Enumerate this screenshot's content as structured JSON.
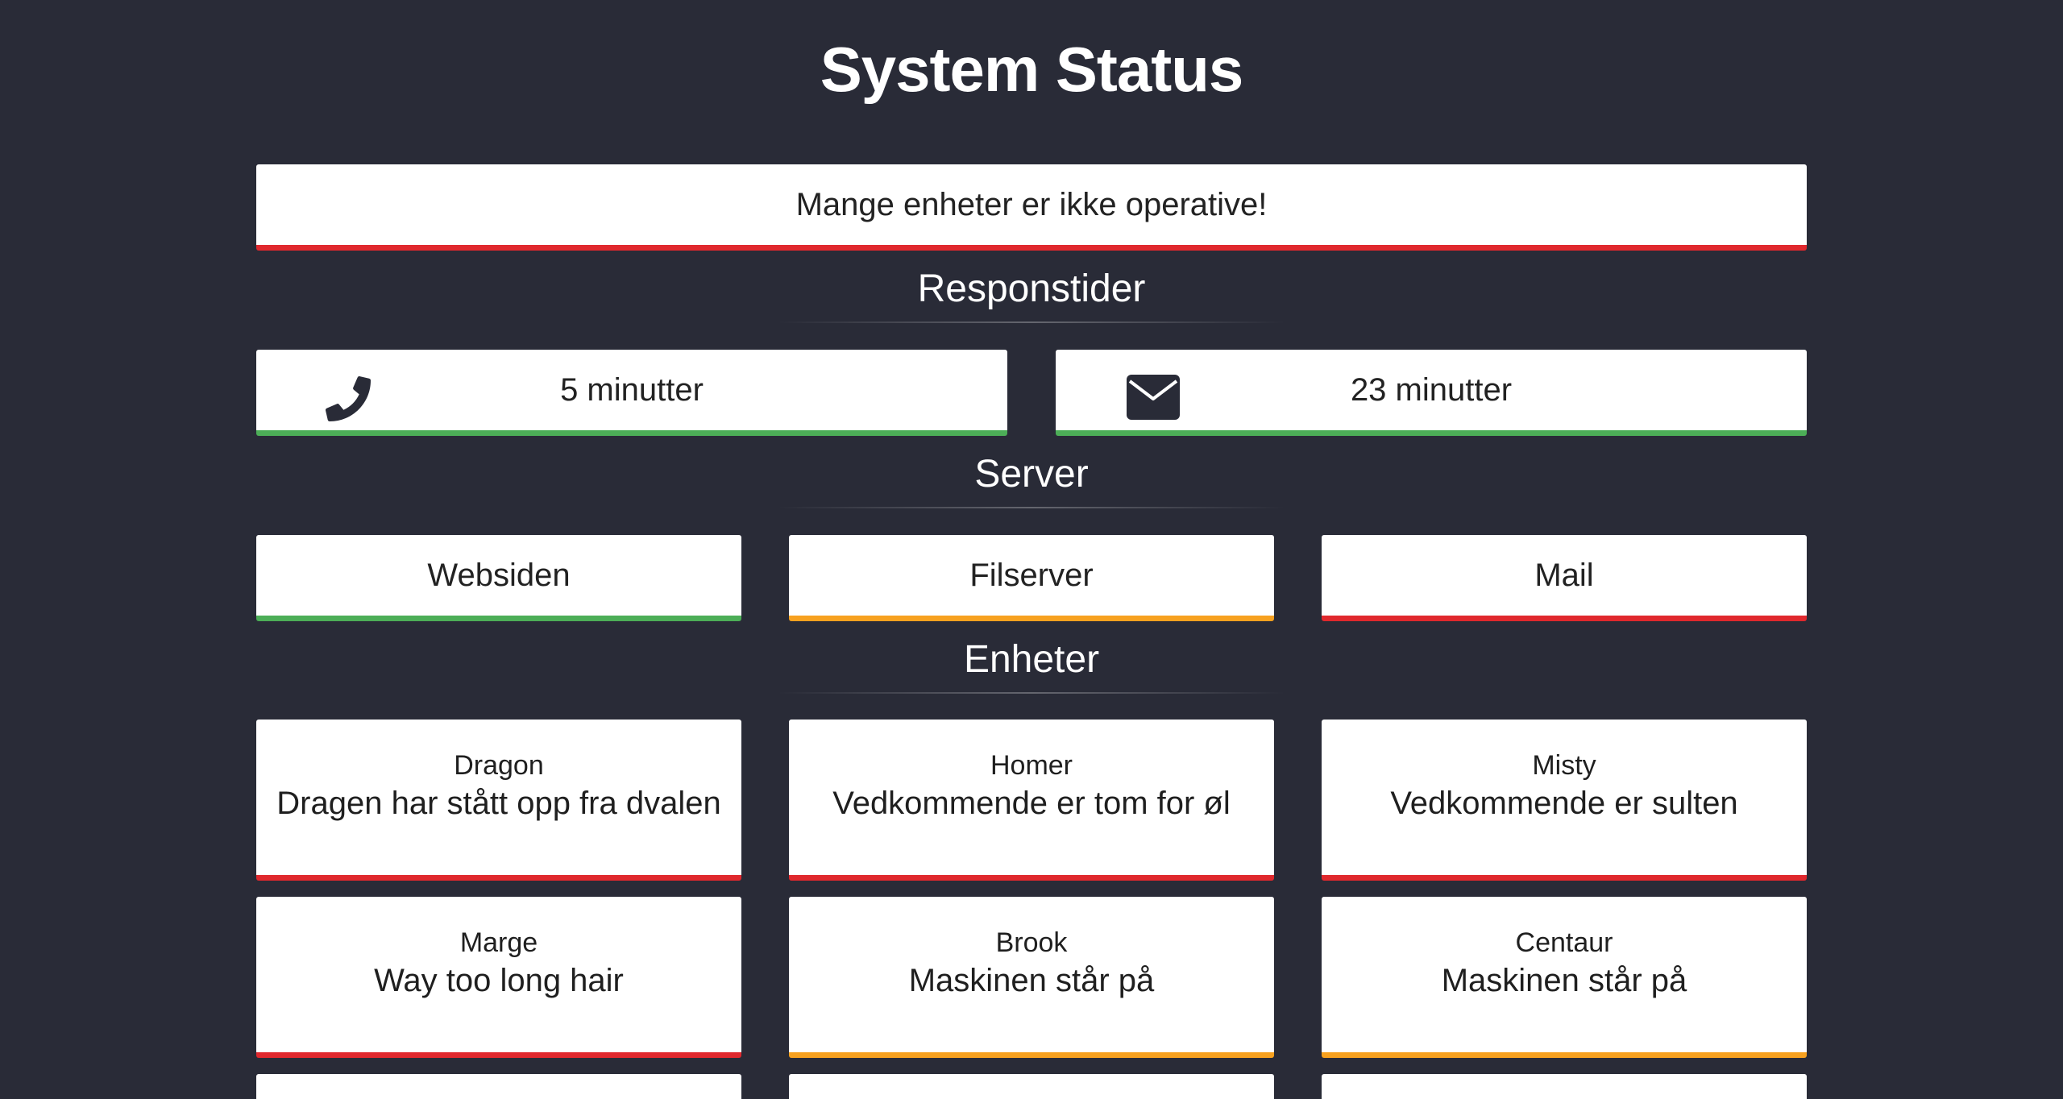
{
  "page": {
    "title": "System Status",
    "banner": {
      "text": "Mange enheter er ikke operative!",
      "status": "red"
    }
  },
  "sections": {
    "response": "Responstider",
    "server": "Server",
    "devices": "Enheter"
  },
  "response_times": [
    {
      "icon": "phone-icon",
      "label": "5 minutter",
      "status": "green"
    },
    {
      "icon": "envelope-icon",
      "label": "23 minutter",
      "status": "green"
    }
  ],
  "servers": [
    {
      "label": "Websiden",
      "status": "green"
    },
    {
      "label": "Filserver",
      "status": "orange"
    },
    {
      "label": "Mail",
      "status": "red"
    }
  ],
  "devices": [
    {
      "name": "Dragon",
      "message": "Dragen har stått opp fra dvalen",
      "status": "red"
    },
    {
      "name": "Homer",
      "message": "Vedkommende er tom for øl",
      "status": "red"
    },
    {
      "name": "Misty",
      "message": "Vedkommende er sulten",
      "status": "red"
    },
    {
      "name": "Marge",
      "message": "Way too long hair",
      "status": "red"
    },
    {
      "name": "Brook",
      "message": "Maskinen står på",
      "status": "orange"
    },
    {
      "name": "Centaur",
      "message": "Maskinen står på",
      "status": "orange"
    }
  ],
  "colors": {
    "background": "#292b37",
    "green": "#4cae57",
    "orange": "#f7a11f",
    "red": "#e0282d",
    "icon": "#292b37"
  }
}
